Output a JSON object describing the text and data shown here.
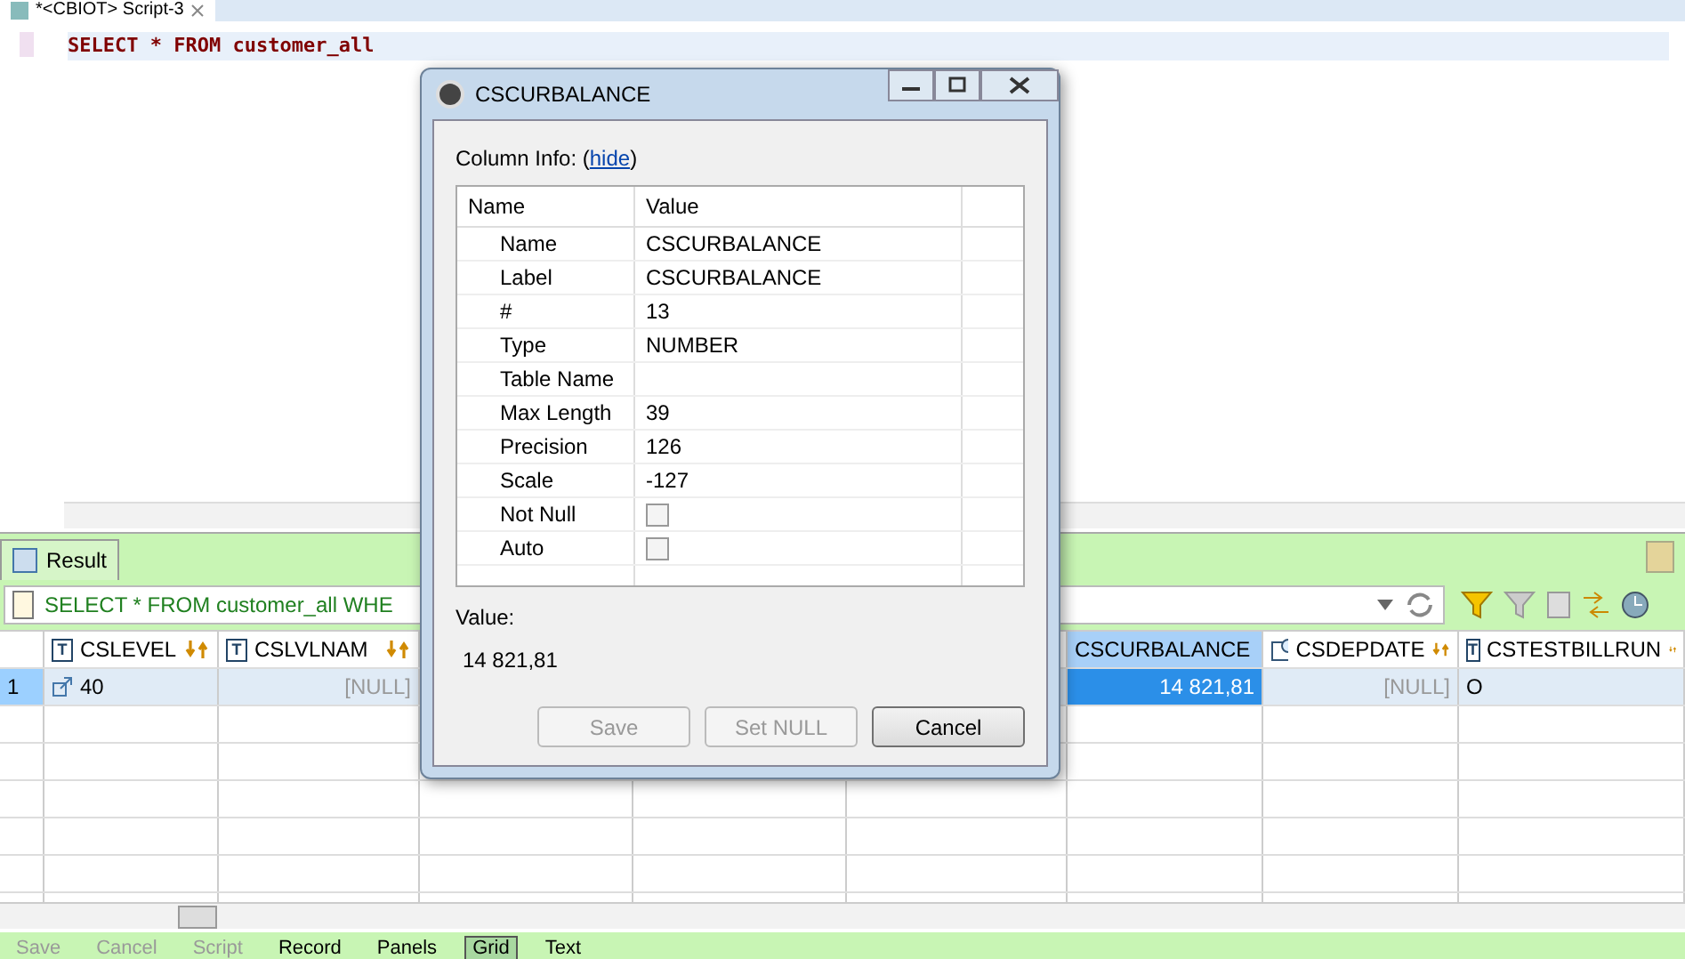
{
  "editor": {
    "tab": {
      "title": "*<CBIOT> Script-3",
      "selected": true
    },
    "sql_visible": "SELECT * FROM customer_all"
  },
  "result": {
    "tab": {
      "label": "Result",
      "selected": true
    },
    "filter": {
      "value": "SELECT * FROM customer_all WHE"
    },
    "columns": [
      {
        "name": "CSLEVEL",
        "kind": "text",
        "icon_letter": "T",
        "selected": false
      },
      {
        "name": "CSLVLNAM",
        "kind": "text",
        "icon_letter": "T",
        "selected": false
      },
      {
        "name": "CSCURBALANCE",
        "kind": "number",
        "selected": true
      },
      {
        "name": "CSDEPDATE",
        "kind": "date",
        "selected": false
      },
      {
        "name": "CSTESTBILLRUN",
        "kind": "text",
        "icon_letter": "T",
        "selected": false
      }
    ],
    "rows": [
      {
        "number": "1",
        "selected": true,
        "cells": [
          {
            "text": "40",
            "kind": "link",
            "selected": false
          },
          {
            "text": "[NULL]",
            "kind": "null",
            "selected": false
          },
          {
            "text": "14 821,81",
            "kind": "plain",
            "selected": true
          },
          {
            "text": "[NULL]",
            "kind": "null",
            "selected": false
          },
          {
            "text": "O",
            "kind": "plain",
            "selected": false
          }
        ]
      }
    ]
  },
  "toolbar": [
    {
      "label": "Save",
      "kind": "action",
      "disabled": true
    },
    {
      "label": "Cancel",
      "kind": "action",
      "disabled": true
    },
    {
      "label": "Script",
      "kind": "action",
      "disabled": true
    },
    {
      "label": "Record",
      "kind": "view",
      "selected": false
    },
    {
      "label": "Panels",
      "kind": "view",
      "selected": false
    },
    {
      "label": "Grid",
      "kind": "view",
      "selected": true
    },
    {
      "label": "Text",
      "kind": "view",
      "selected": false
    }
  ],
  "dialog": {
    "title": "CSCURBALANCE",
    "column_info": {
      "label": "Column Info: (",
      "link": "hide",
      "after": ")"
    },
    "table": {
      "columns": [
        "Name",
        "Value"
      ],
      "rows": [
        {
          "name": "Name",
          "kind": "text",
          "value": "CSCURBALANCE"
        },
        {
          "name": "Label",
          "kind": "text",
          "value": "CSCURBALANCE"
        },
        {
          "name": "#",
          "kind": "text",
          "value": "13"
        },
        {
          "name": "Type",
          "kind": "text",
          "value": "NUMBER"
        },
        {
          "name": "Table Name",
          "kind": "text"
        },
        {
          "name": "Max Length",
          "kind": "text",
          "value": "39"
        },
        {
          "name": "Precision",
          "kind": "text",
          "value": "126"
        },
        {
          "name": "Scale",
          "kind": "text",
          "value": "-127"
        },
        {
          "name": "Not Null",
          "kind": "checkbox",
          "checked": false
        },
        {
          "name": "Auto",
          "kind": "checkbox",
          "checked": false
        }
      ]
    },
    "value_label": "Value:",
    "value": "14 821,81",
    "buttons": [
      {
        "label": "Save",
        "disabled": true
      },
      {
        "label": "Set NULL",
        "disabled": true
      },
      {
        "label": "Cancel",
        "disabled": false
      }
    ]
  }
}
